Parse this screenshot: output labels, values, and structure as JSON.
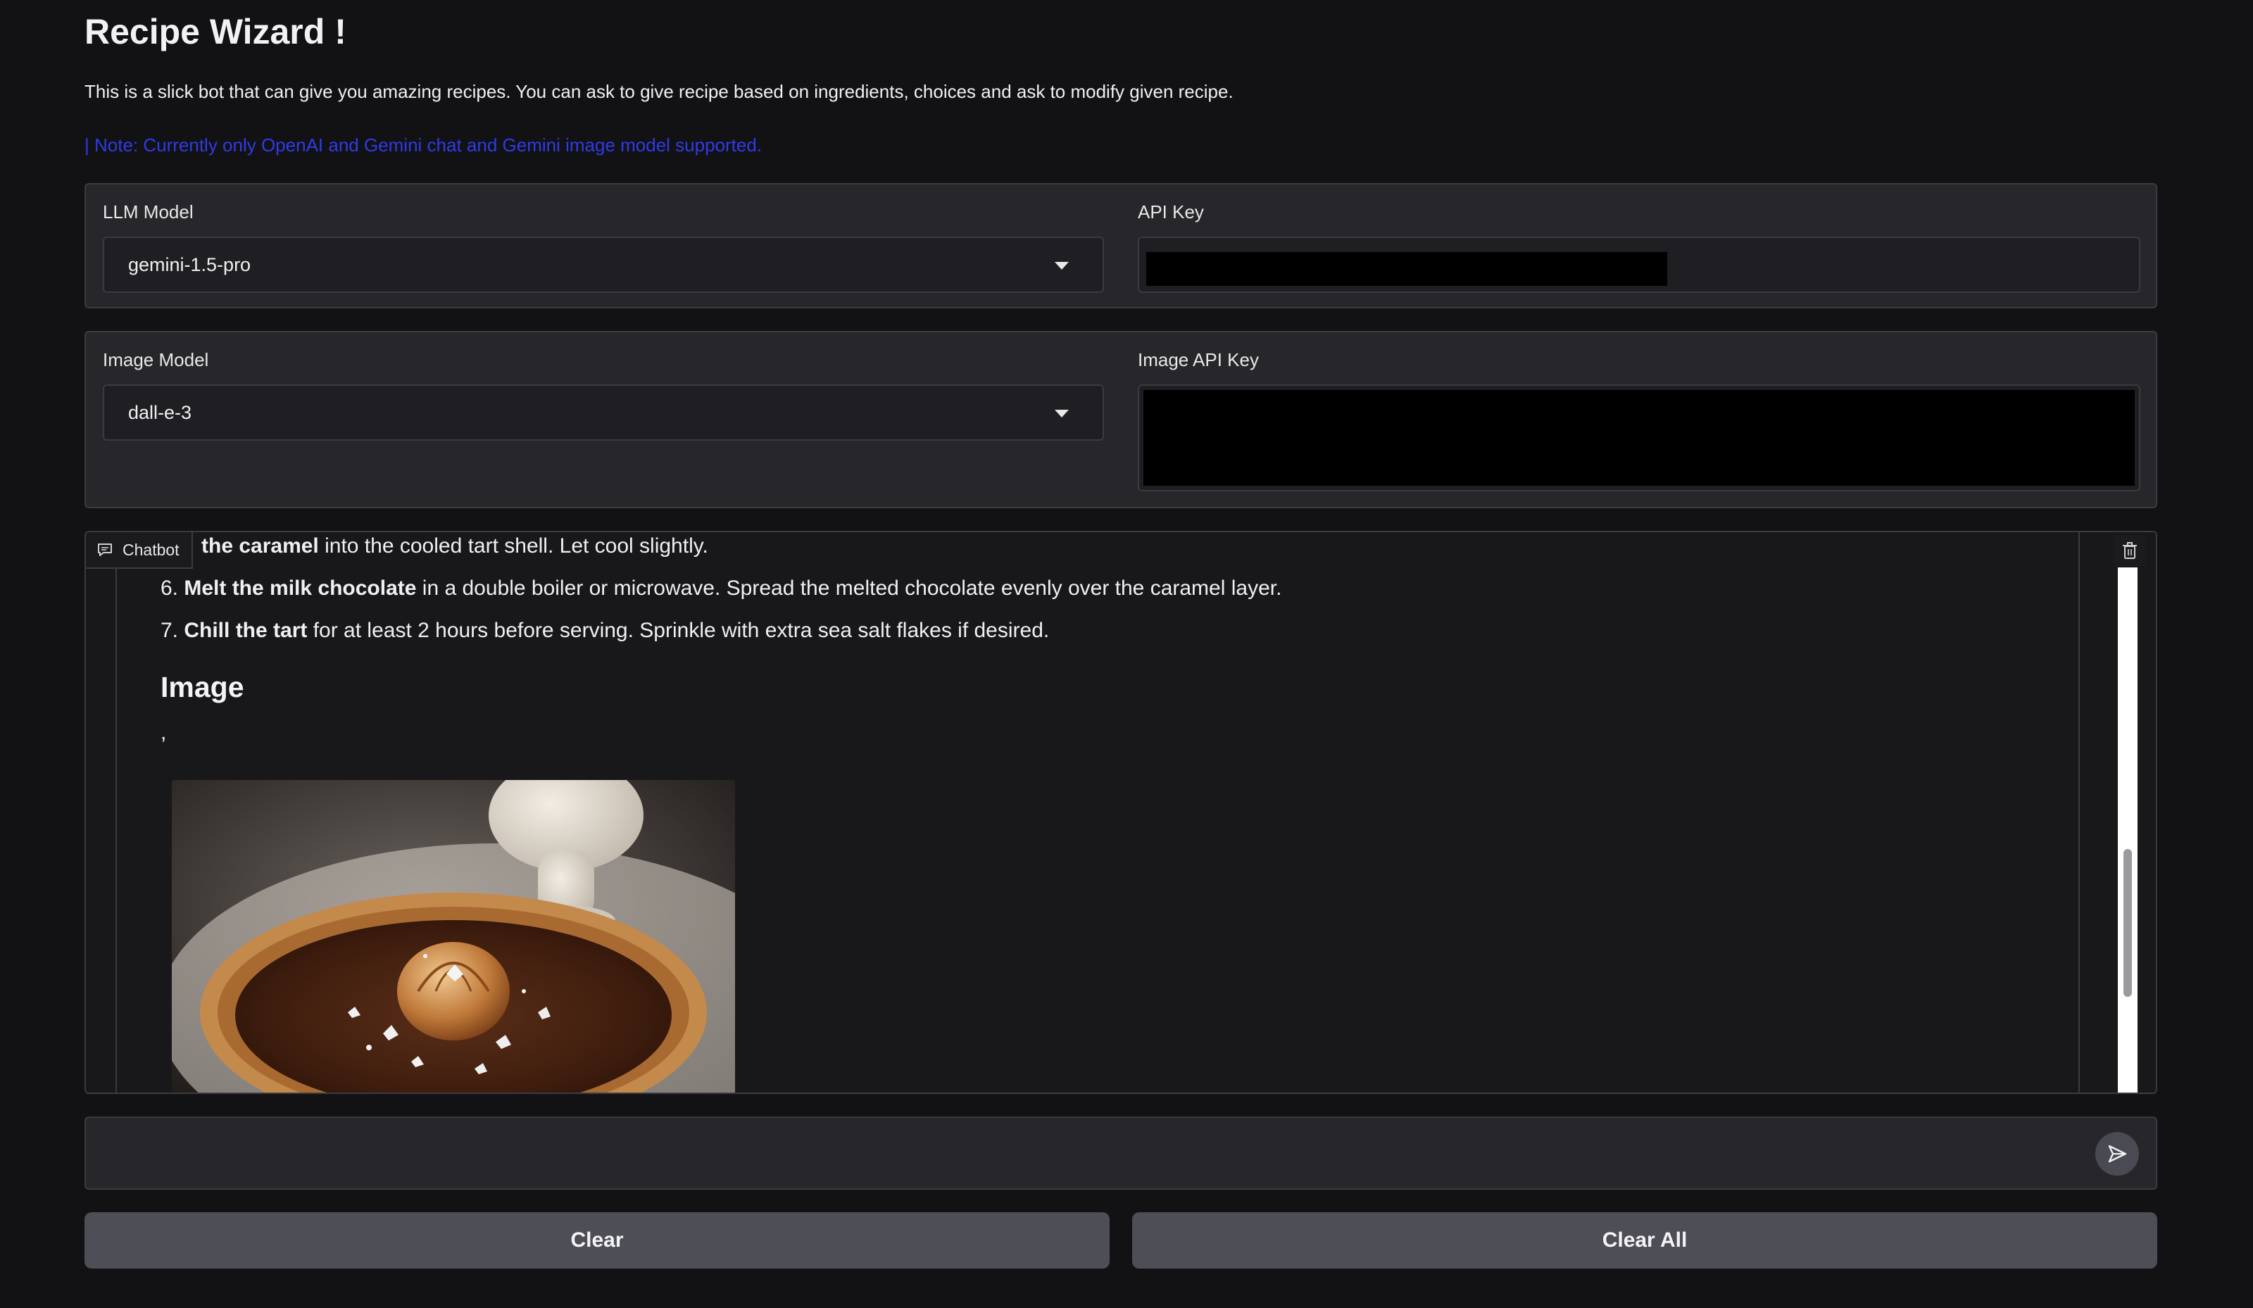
{
  "header": {
    "title": "Recipe Wizard !",
    "description": "This is a slick bot that can give you amazing recipes. You can ask to give recipe based on ingredients, choices and ask to modify given recipe.",
    "note": "| Note: Currently only OpenAI and Gemini chat and Gemini image model supported."
  },
  "llm": {
    "model_label": "LLM Model",
    "model_value": "gemini-1.5-pro",
    "api_key_label": "API Key"
  },
  "image": {
    "model_label": "Image Model",
    "model_value": "dall-e-3",
    "api_key_label": "Image API Key"
  },
  "chatbot": {
    "label": "Chatbot",
    "step5_bold": "the caramel",
    "step5_rest": " into the cooled tart shell. Let cool slightly.",
    "step6_num": "6. ",
    "step6_bold": "Melt the milk chocolate",
    "step6_rest": " in a double boiler or microwave. Spread the melted chocolate evenly over the caramel layer.",
    "step7_num": "7. ",
    "step7_bold": "Chill the tart",
    "step7_rest": " for at least 2 hours before serving. Sprinkle with extra sea salt flakes if desired.",
    "image_heading": "Image",
    "comma": ","
  },
  "input": {
    "placeholder": ""
  },
  "buttons": {
    "clear": "Clear",
    "clear_all": "Clear All"
  },
  "colors": {
    "background": "#121214",
    "panel": "#27272b",
    "note_text": "#2f3be8",
    "button": "#4e4e57"
  }
}
